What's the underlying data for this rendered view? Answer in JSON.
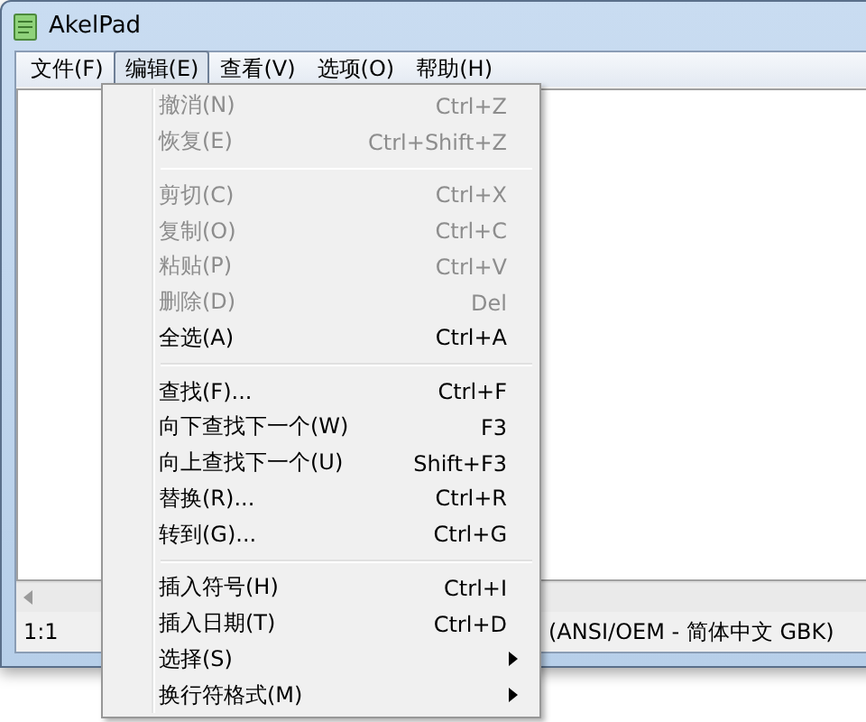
{
  "window": {
    "title": "AkelPad"
  },
  "menubar": [
    {
      "label": "文件(F)",
      "selected": false
    },
    {
      "label": "编辑(E)",
      "selected": true
    },
    {
      "label": "查看(V)",
      "selected": false
    },
    {
      "label": "选项(O)",
      "selected": false
    },
    {
      "label": "帮助(H)",
      "selected": false
    }
  ],
  "status_bar": {
    "position": "1:1",
    "encoding": "(ANSI/OEM - 简体中文 GBK)"
  },
  "menu": {
    "groups": [
      [
        {
          "kind": "command",
          "label": "撤消(N)",
          "shortcut": "Ctrl+Z",
          "disabled": true
        },
        {
          "kind": "command",
          "label": "恢复(E)",
          "shortcut": "Ctrl+Shift+Z",
          "disabled": true
        }
      ],
      [
        {
          "kind": "command",
          "label": "剪切(C)",
          "shortcut": "Ctrl+X",
          "disabled": true
        },
        {
          "kind": "command",
          "label": "复制(O)",
          "shortcut": "Ctrl+C",
          "disabled": true
        },
        {
          "kind": "command",
          "label": "粘贴(P)",
          "shortcut": "Ctrl+V",
          "disabled": true
        },
        {
          "kind": "command",
          "label": "删除(D)",
          "shortcut": "Del",
          "disabled": true
        },
        {
          "kind": "command",
          "label": "全选(A)",
          "shortcut": "Ctrl+A",
          "disabled": false
        }
      ],
      [
        {
          "kind": "command",
          "label": "查找(F)...",
          "shortcut": "Ctrl+F",
          "disabled": false
        },
        {
          "kind": "command",
          "label": "向下查找下一个(W)",
          "shortcut": "F3",
          "disabled": false
        },
        {
          "kind": "command",
          "label": "向上查找下一个(U)",
          "shortcut": "Shift+F3",
          "disabled": false
        },
        {
          "kind": "command",
          "label": "替换(R)...",
          "shortcut": "Ctrl+R",
          "disabled": false
        },
        {
          "kind": "command",
          "label": "转到(G)...",
          "shortcut": "Ctrl+G",
          "disabled": false
        }
      ],
      [
        {
          "kind": "command",
          "label": "插入符号(H)",
          "shortcut": "Ctrl+I",
          "disabled": false
        },
        {
          "kind": "command",
          "label": "插入日期(T)",
          "shortcut": "Ctrl+D",
          "disabled": false
        },
        {
          "kind": "submenu",
          "label": "选择(S)",
          "disabled": false
        },
        {
          "kind": "submenu",
          "label": "换行符格式(M)",
          "disabled": false
        }
      ]
    ]
  }
}
